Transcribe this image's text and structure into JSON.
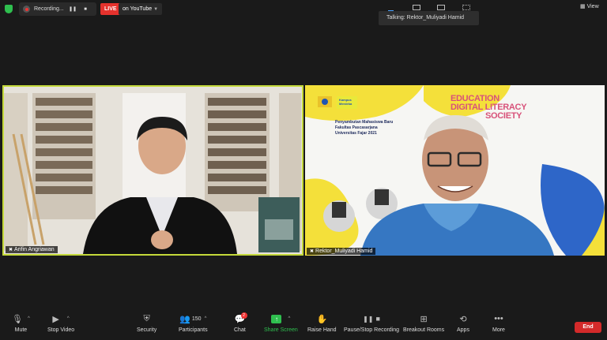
{
  "topbar": {
    "recording_label": "Recording...",
    "live_label": "LIVE",
    "youtube_label": "on YouTube",
    "talking_label": "Talking: Rektor_Muliyadi Hamid",
    "view_label": "View"
  },
  "participants": [
    {
      "name": "Arifin Angriawan"
    },
    {
      "name": "Rektor_Muliyadi Hamid"
    }
  ],
  "slide": {
    "event_title": "Penyambutan Mahasiswa Baru",
    "faculty": "Fakultas Pascasarjana",
    "university": "Universitas Fajar 2021",
    "headline_line1": "EDUCATION",
    "headline_line2": "DIGITAL LITERACY",
    "headline_line3": "SOCIETY",
    "logo_text": "Kampus Merdeka"
  },
  "toolbar": {
    "mute": "Mute",
    "stop_video": "Stop Video",
    "security": "Security",
    "participants": "Participants",
    "participants_count": "150",
    "chat": "Chat",
    "chat_badge": "2",
    "share_screen": "Share Screen",
    "raise_hand": "Raise Hand",
    "pause_stop_recording": "Pause/Stop Recording",
    "breakout_rooms": "Breakout Rooms",
    "apps": "Apps",
    "more": "More",
    "end": "End"
  },
  "colors": {
    "active_speaker_border": "#c4d93a",
    "share_green": "#2fbf4f",
    "end_red": "#d32a2a",
    "live_red": "#e5322d"
  }
}
